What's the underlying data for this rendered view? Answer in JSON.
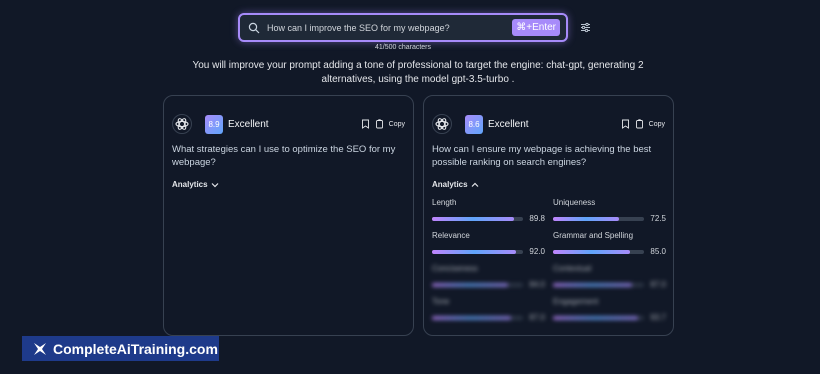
{
  "search": {
    "placeholder": "How can I improve the SEO for my webpage?",
    "enter_label": "⌘+Enter",
    "char_count": "41/500 characters"
  },
  "intro_text": "You will improve your prompt adding a tone of professional to target the engine: chat-gpt, generating 2 alternatives, using the model gpt-3.5-turbo .",
  "cards": [
    {
      "score": "8.9",
      "rating": "Excellent",
      "copy_label": "Copy",
      "text": "What strategies can I use to optimize the SEO for my webpage?",
      "analytics_label": "Analytics",
      "analytics_expanded": false
    },
    {
      "score": "8.6",
      "rating": "Excellent",
      "copy_label": "Copy",
      "text": "How can I ensure my webpage is achieving the best possible ranking on search engines?",
      "analytics_label": "Analytics",
      "analytics_expanded": true,
      "metrics": [
        {
          "label": "Length",
          "value": "89.8",
          "fill": 0.898
        },
        {
          "label": "Uniqueness",
          "value": "72.5",
          "fill": 0.725
        },
        {
          "label": "Relevance",
          "value": "92.0",
          "fill": 0.92
        },
        {
          "label": "Grammar and Spelling",
          "value": "85.0",
          "fill": 0.85
        },
        {
          "label": "Conciseness",
          "value": "84.0",
          "fill": 0.84
        },
        {
          "label": "Contextual",
          "value": "87.0",
          "fill": 0.87
        },
        {
          "label": "Tone",
          "value": "87.0",
          "fill": 0.87
        },
        {
          "label": "Engagement",
          "value": "93.7",
          "fill": 0.937
        }
      ]
    }
  ],
  "brand": {
    "name": "CompleteAiTraining.com"
  },
  "colors": {
    "accent": "#a78bfa",
    "background": "#111827",
    "brand_bg": "#1e3a8a"
  }
}
